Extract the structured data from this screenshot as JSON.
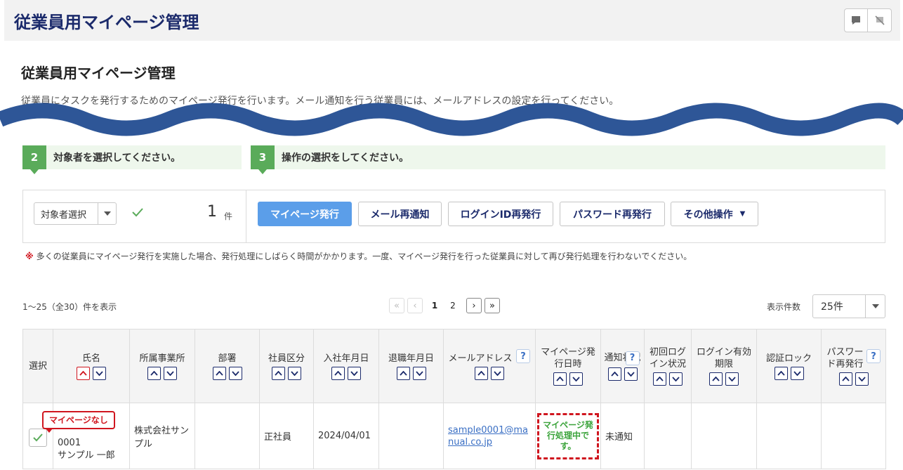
{
  "header": {
    "title": "従業員用マイページ管理"
  },
  "page": {
    "title": "従業員用マイページ管理",
    "description": "従業員にタスクを発行するためのマイページ発行を行います。メール通知を行う従業員には、メールアドレスの設定を行ってください。"
  },
  "steps": [
    {
      "num": "2",
      "label": "対象者を選択してください。"
    },
    {
      "num": "3",
      "label": "操作の選択をしてください。"
    }
  ],
  "selection": {
    "select_label": "対象者選択",
    "count": "1",
    "unit": "件"
  },
  "actions": {
    "issue": "マイページ発行",
    "resend_mail": "メール再通知",
    "reissue_login": "ログインID再発行",
    "reissue_password": "パスワード再発行",
    "other": "その他操作"
  },
  "note": {
    "mark": "※",
    "text": "多くの従業員にマイページ発行を実施した場合、発行処理にしばらく時間がかかります。一度、マイページ発行を行った従業員に対して再び発行処理を行わないでください。"
  },
  "pagination": {
    "range": "1～25（全30）件を表示",
    "pages": [
      "1",
      "2"
    ],
    "current": "1"
  },
  "perpage": {
    "label": "表示件数",
    "value": "25件"
  },
  "table": {
    "headers": {
      "select": "選択",
      "name": "氏名",
      "office": "所属事業所",
      "dept": "部署",
      "emp_type": "社員区分",
      "join_date": "入社年月日",
      "leave_date": "退職年月日",
      "email": "メールアドレス",
      "mp_date": "マイページ発行日時",
      "notify": "通知状況",
      "first_login": "初回ログイン状況",
      "login_expiry": "ログイン有効期限",
      "auth_lock": "認証ロック",
      "pw_reissue": "パスワード再発行"
    },
    "row": {
      "badge": "マイページなし",
      "emp_no": "0001",
      "name": "サンプル 一郎",
      "office": "株式会社サンプル",
      "dept": "",
      "emp_type": "正社員",
      "join_date": "2024/04/01",
      "leave_date": "",
      "email": "sample0001@manual.co.jp",
      "mp_status": "マイページ発行処理中です。",
      "notify": "未通知"
    }
  },
  "colors": {
    "brand": "#1b2a6b",
    "primary": "#5b9ee9",
    "step": "#5aab5a",
    "alert": "#d0161f",
    "processing": "#3aa33a",
    "wave": "#2e5697"
  },
  "icons": [
    "chat-icon",
    "notification-off-icon",
    "chevron-down-icon",
    "check-icon",
    "sort-up-icon",
    "sort-down-icon",
    "help-icon",
    "first-page-icon",
    "prev-page-icon",
    "next-page-icon",
    "last-page-icon"
  ]
}
